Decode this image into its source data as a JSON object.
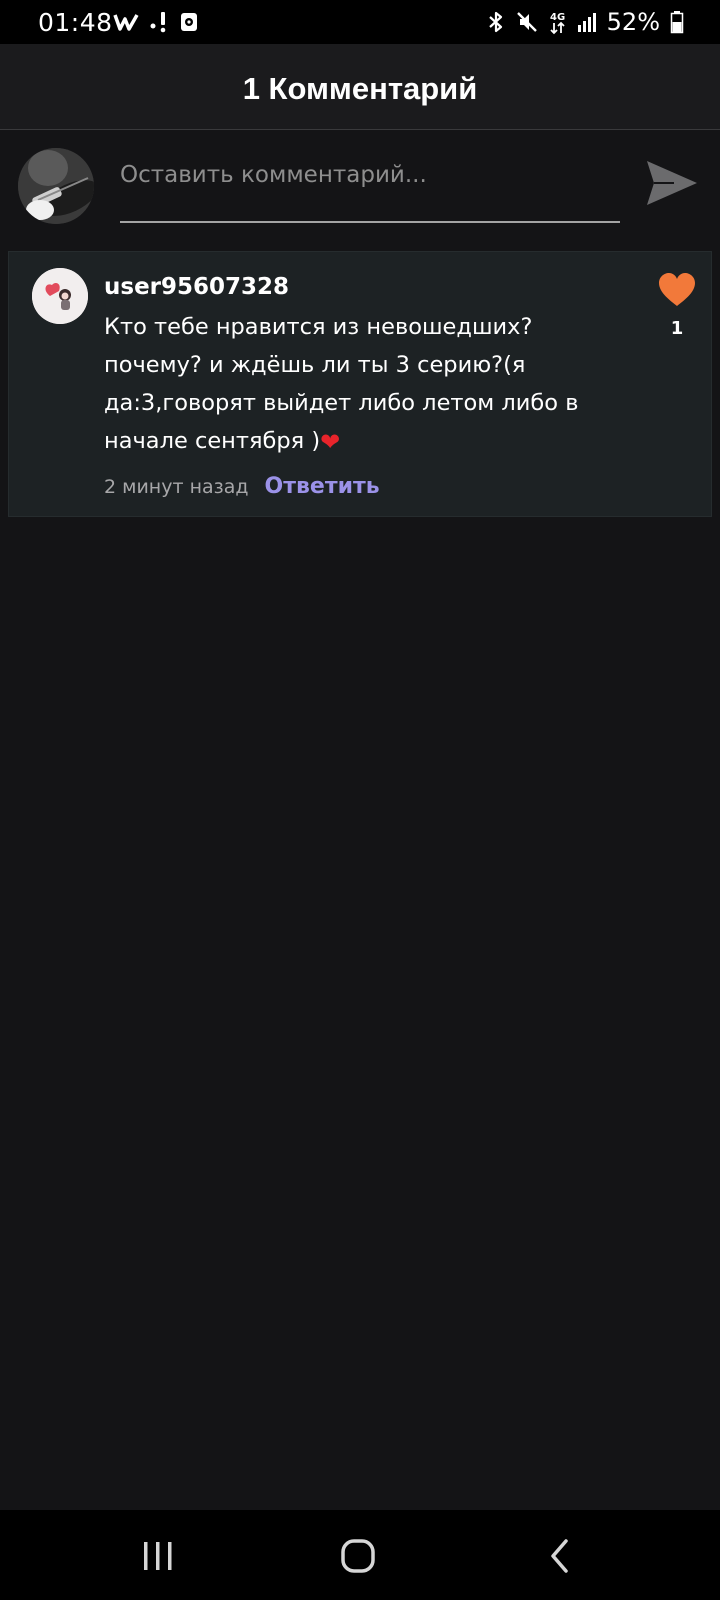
{
  "status_bar": {
    "time": "01:48",
    "left_icons": [
      "w-app-icon",
      "exclamation-icon",
      "media-icon"
    ],
    "right_icons": [
      "bluetooth-icon",
      "mute-icon",
      "4g-data-icon",
      "signal-icon",
      "battery-icon"
    ],
    "network_label": "4G",
    "battery": "52%"
  },
  "header": {
    "title": "1 Комментарий"
  },
  "comment_input": {
    "placeholder": "Оставить комментарий...",
    "value": "",
    "send_icon": "send-icon"
  },
  "comments": [
    {
      "username": "user95607328",
      "text": "Кто тебе нравится из невошедших?почему? и ждёшь ли ты 3 серию?(я да:3,говорят выйдет либо летом либо в начале сентября )",
      "emoji": "❤",
      "time": "2 минут назад",
      "reply_label": "Ответить",
      "likes": "1",
      "liked": true,
      "like_icon": "heart-icon"
    }
  ],
  "nav_bar": {
    "buttons": [
      "recents-icon",
      "home-icon",
      "back-icon"
    ]
  },
  "colors": {
    "background": "#141416",
    "header": "#1b1b1d",
    "card": "#1d2224",
    "accent_reply": "#9b92e8",
    "like": "#f2793a"
  }
}
